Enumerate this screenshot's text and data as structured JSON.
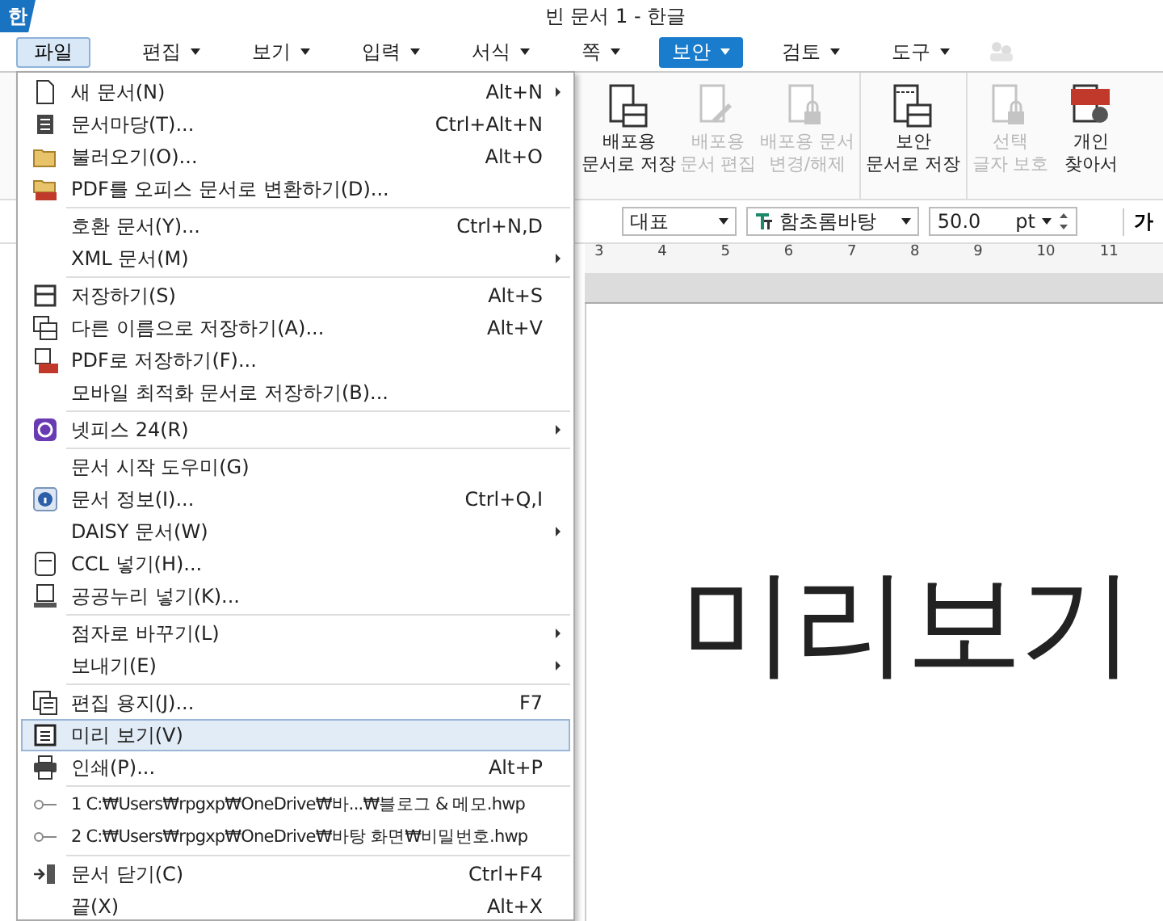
{
  "window": {
    "app_icon": "한",
    "title": "빈 문서 1 - 한글"
  },
  "menu_bar": {
    "file_button": {
      "label": "파일",
      "open": true
    },
    "tabs": [
      {
        "label": "편집",
        "selected": false
      },
      {
        "label": "보기",
        "selected": false
      },
      {
        "label": "입력",
        "selected": false
      },
      {
        "label": "서식",
        "selected": false
      },
      {
        "label": "쪽",
        "selected": false
      },
      {
        "label": "보안",
        "selected": true
      },
      {
        "label": "검토",
        "selected": false
      },
      {
        "label": "도구",
        "selected": false
      }
    ]
  },
  "ribbon": {
    "groups": [
      [
        {
          "lines": [
            "배포용",
            "문서로 저장"
          ],
          "disabled": false
        },
        {
          "lines": [
            "배포용",
            "문서 편집"
          ],
          "disabled": true
        },
        {
          "lines": [
            "배포용 문서",
            "변경/해제"
          ],
          "disabled": true
        }
      ],
      [
        {
          "lines": [
            "보안",
            "문서로 저장"
          ],
          "disabled": false
        }
      ],
      [
        {
          "lines": [
            "선택",
            "글자 보호"
          ],
          "disabled": true
        },
        {
          "lines": [
            "개인",
            "찾아서"
          ],
          "disabled": false
        }
      ]
    ]
  },
  "format_bar": {
    "style": "대표",
    "font": "함초롬바탕",
    "size": "50.0",
    "unit": "pt",
    "char_button": "가"
  },
  "ruler": {
    "numbers": [
      "3",
      "4",
      "5",
      "6",
      "7",
      "8",
      "9",
      "10",
      "11"
    ]
  },
  "document": {
    "text": "미리보기"
  },
  "file_menu": {
    "sections": [
      [
        {
          "label": "새 문서(N)",
          "shortcut": "Alt+N",
          "submenu": true,
          "selected": false
        },
        {
          "label": "문서마당(T)...",
          "shortcut": "Ctrl+Alt+N",
          "submenu": false,
          "selected": false
        },
        {
          "label": "불러오기(O)...",
          "shortcut": "Alt+O",
          "submenu": false,
          "selected": false
        },
        {
          "label": "PDF를 오피스 문서로 변환하기(D)...",
          "submenu": false,
          "selected": false
        }
      ],
      [
        {
          "label": "호환 문서(Y)...",
          "shortcut": "Ctrl+N,D",
          "submenu": false,
          "selected": false
        },
        {
          "label": "XML 문서(M)",
          "submenu": true,
          "selected": false
        }
      ],
      [
        {
          "label": "저장하기(S)",
          "shortcut": "Alt+S",
          "submenu": false,
          "selected": false
        },
        {
          "label": "다른 이름으로 저장하기(A)...",
          "shortcut": "Alt+V",
          "submenu": false,
          "selected": false
        },
        {
          "label": "PDF로 저장하기(F)...",
          "submenu": false,
          "selected": false
        },
        {
          "label": "모바일 최적화 문서로 저장하기(B)...",
          "submenu": false,
          "selected": false
        }
      ],
      [
        {
          "label": "넷피스 24(R)",
          "submenu": true,
          "selected": false
        }
      ],
      [
        {
          "label": "문서 시작 도우미(G)",
          "submenu": false,
          "selected": false
        },
        {
          "label": "문서 정보(I)...",
          "shortcut": "Ctrl+Q,I",
          "submenu": false,
          "selected": false
        },
        {
          "label": "DAISY 문서(W)",
          "submenu": true,
          "selected": false
        },
        {
          "label": "CCL 넣기(H)...",
          "submenu": false,
          "selected": false
        },
        {
          "label": "공공누리 넣기(K)...",
          "submenu": false,
          "selected": false
        }
      ],
      [
        {
          "label": "점자로 바꾸기(L)",
          "submenu": true,
          "selected": false
        },
        {
          "label": "보내기(E)",
          "submenu": true,
          "selected": false
        }
      ],
      [
        {
          "label": "편집 용지(J)...",
          "shortcut": "F7",
          "submenu": false,
          "selected": false
        },
        {
          "label": "미리 보기(V)",
          "submenu": false,
          "selected": true
        },
        {
          "label": "인쇄(P)...",
          "shortcut": "Alt+P",
          "submenu": false,
          "selected": false
        }
      ],
      [
        {
          "label": "1 C:₩Users₩rpgxp₩OneDrive₩바...₩블로그 & 메모.hwp",
          "submenu": false,
          "selected": false
        },
        {
          "label": "2 C:₩Users₩rpgxp₩OneDrive₩바탕 화면₩비밀번호.hwp",
          "submenu": false,
          "selected": false
        }
      ],
      [
        {
          "label": "문서 닫기(C)",
          "shortcut": "Ctrl+F4",
          "submenu": false,
          "selected": false
        },
        {
          "label": "끝(X)",
          "shortcut": "Alt+X",
          "submenu": false,
          "selected": false
        }
      ]
    ]
  }
}
